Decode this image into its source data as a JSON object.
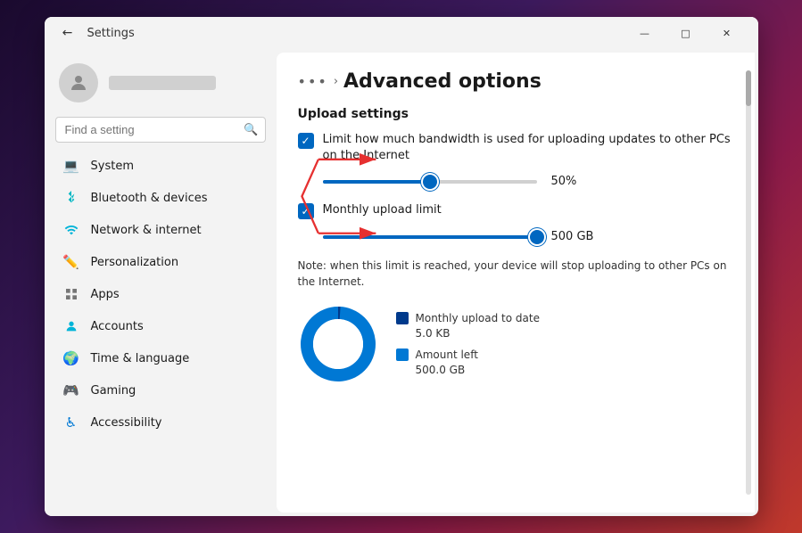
{
  "window": {
    "title": "Settings",
    "back_label": "←",
    "minimize_label": "—",
    "maximize_label": "□",
    "close_label": "✕"
  },
  "sidebar": {
    "search_placeholder": "Find a setting",
    "search_icon": "🔍",
    "nav_items": [
      {
        "id": "system",
        "label": "System",
        "icon": "💻",
        "icon_class": "blue"
      },
      {
        "id": "bluetooth",
        "label": "Bluetooth & devices",
        "icon": "🔵",
        "icon_class": "cyan"
      },
      {
        "id": "network",
        "label": "Network & internet",
        "icon": "🌐",
        "icon_class": "teal"
      },
      {
        "id": "personalization",
        "label": "Personalization",
        "icon": "✏️",
        "icon_class": "orange"
      },
      {
        "id": "apps",
        "label": "Apps",
        "icon": "📦",
        "icon_class": "gray"
      },
      {
        "id": "accounts",
        "label": "Accounts",
        "icon": "👤",
        "icon_class": "teal"
      },
      {
        "id": "time",
        "label": "Time & language",
        "icon": "🌍",
        "icon_class": "blue"
      },
      {
        "id": "gaming",
        "label": "Gaming",
        "icon": "🎮",
        "icon_class": "gray"
      },
      {
        "id": "accessibility",
        "label": "Accessibility",
        "icon": "♿",
        "icon_class": "blue"
      }
    ]
  },
  "content": {
    "breadcrumb_dots": "•••",
    "breadcrumb_chevron": "›",
    "page_title": "Advanced options",
    "upload_section_title": "Upload settings",
    "checkbox1_label": "Limit how much bandwidth is used for uploading updates to other PCs on the Internet",
    "checkbox1_checked": true,
    "slider1_percent": 50,
    "slider1_fill_percent": 50,
    "slider1_value": "50%",
    "checkbox2_label": "Monthly upload limit",
    "checkbox2_checked": true,
    "slider2_percent": 100,
    "slider2_fill_percent": 100,
    "slider2_value": "500 GB",
    "note_text": "Note: when this limit is reached, your device will stop uploading to other PCs on the Internet.",
    "legend_item1_label": "Monthly upload to date",
    "legend_item1_value": "5.0 KB",
    "legend_item2_label": "Amount left",
    "legend_item2_value": "500.0 GB",
    "donut_used_percent": 1,
    "donut_left_percent": 99
  }
}
